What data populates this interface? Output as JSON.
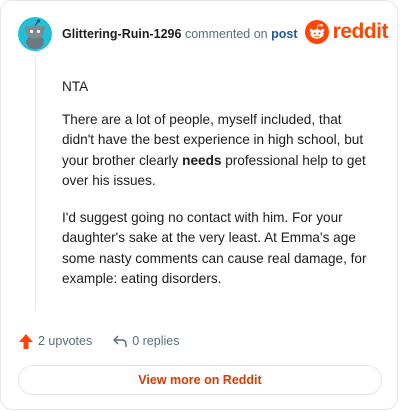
{
  "header": {
    "username": "Glittering-Ruin-1296",
    "commented_text": "commented on",
    "post_link": "post",
    "brand": "reddit"
  },
  "comment": {
    "p1": "NTA",
    "p2_before": "There are a lot of people, myself included, that didn't have the best experience in high school, but your brother clearly ",
    "p2_bold": "needs",
    "p2_after": " professional help to get over his issues.",
    "p3": "I'd suggest going no contact with him. For your daughter's sake at the very least. At Emma's age some nasty comments can cause real damage, for example: eating disorders."
  },
  "footer": {
    "upvotes": "2 upvotes",
    "replies": "0 replies"
  },
  "button": {
    "label": "View more on Reddit"
  },
  "colors": {
    "brand": "#ff4500",
    "upvote": "#ff4500",
    "link": "#1d5a9c",
    "button_text": "#d93a00"
  },
  "icons": {
    "avatar": "snoo-avatar-icon",
    "logo": "reddit-logo-icon",
    "upvote": "upvote-arrow-icon",
    "reply": "reply-arrow-icon"
  }
}
